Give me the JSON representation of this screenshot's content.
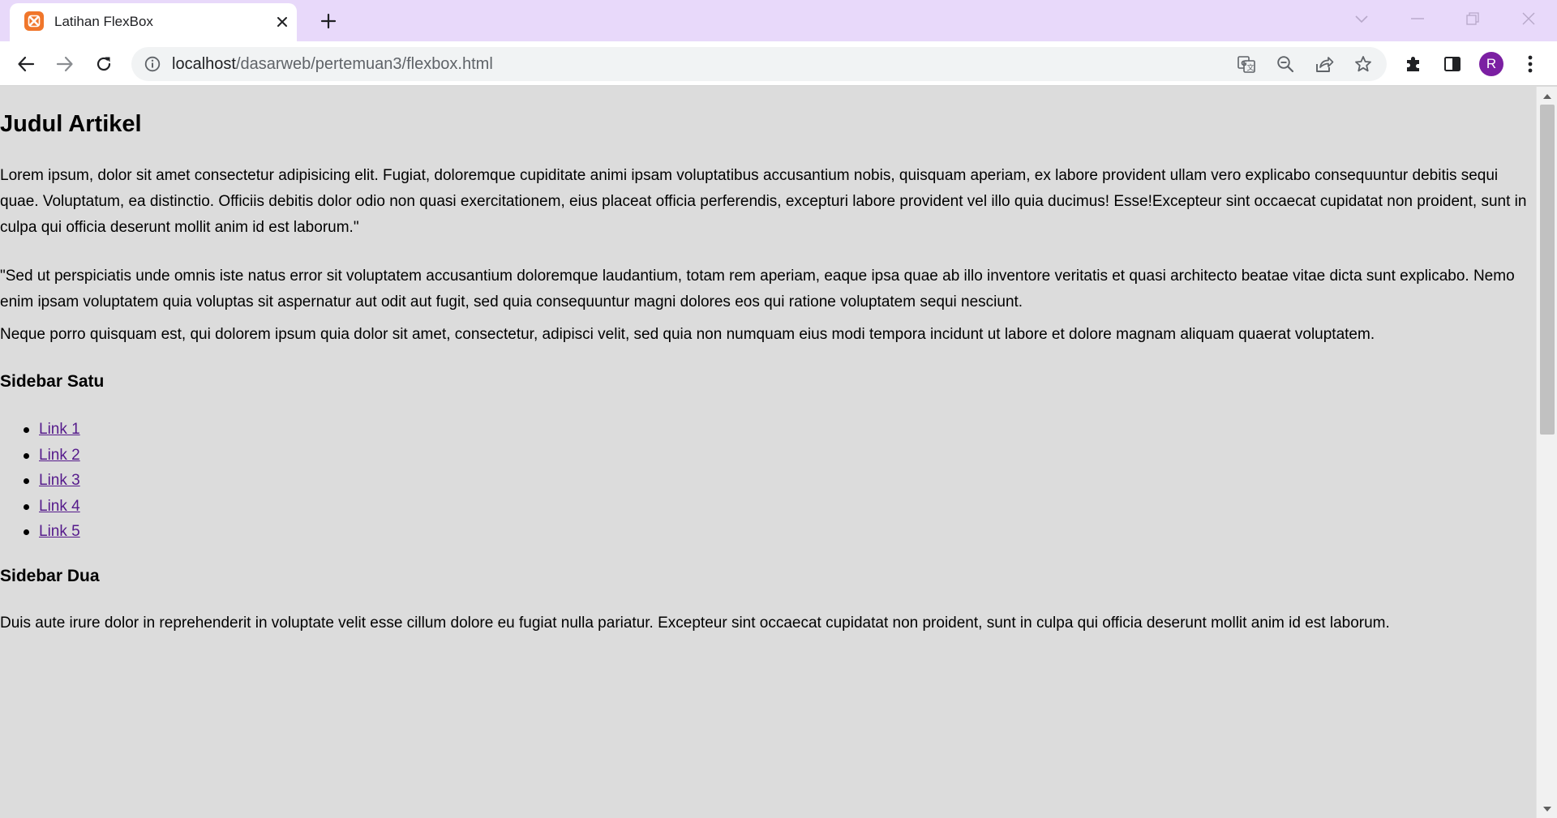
{
  "browser": {
    "tab_title": "Latihan FlexBox",
    "url_host": "localhost",
    "url_path": "/dasarweb/pertemuan3/flexbox.html",
    "profile_initial": "R",
    "accent_color": "#e8d9fa",
    "profile_color": "#7b1fa2"
  },
  "icons": {
    "favicon": "xampp-icon",
    "close": "close-icon",
    "new_tab": "plus-icon",
    "back": "arrow-left-icon",
    "forward": "arrow-right-icon",
    "reload": "reload-icon",
    "info": "info-icon",
    "translate": "translate-icon",
    "zoom": "zoom-out-icon",
    "share": "share-icon",
    "bookmark": "star-icon",
    "extensions": "puzzle-icon",
    "side_panel": "side-panel-icon",
    "menu": "kebab-menu-icon"
  },
  "page": {
    "title": "Judul Artikel",
    "paragraphs": [
      "Lorem ipsum, dolor sit amet consectetur adipisicing elit. Fugiat, doloremque cupiditate animi ipsam voluptatibus accusantium nobis, quisquam aperiam, ex labore provident ullam vero explicabo consequuntur debitis sequi quae. Voluptatum, ea distinctio. Officiis debitis dolor odio non quasi exercitationem, eius placeat officia perferendis, excepturi labore provident vel illo quia ducimus! Esse!Excepteur sint occaecat cupidatat non proident, sunt in culpa qui officia deserunt mollit anim id est laborum.\"",
      "\"Sed ut perspiciatis unde omnis iste natus error sit voluptatem accusantium doloremque laudantium, totam rem aperiam, eaque ipsa quae ab illo inventore veritatis et quasi architecto beatae vitae dicta sunt explicabo. Nemo enim ipsam voluptatem quia voluptas sit aspernatur aut odit aut fugit, sed quia consequuntur magni dolores eos qui ratione voluptatem sequi nesciunt.",
      "Neque porro quisquam est, qui dolorem ipsum quia dolor sit amet, consectetur, adipisci velit, sed quia non numquam eius modi tempora incidunt ut labore et dolore magnam aliquam quaerat voluptatem."
    ],
    "sidebar_one": {
      "title": "Sidebar Satu",
      "links": [
        "Link 1",
        "Link 2",
        "Link 3",
        "Link 4",
        "Link 5"
      ]
    },
    "sidebar_two": {
      "title": "Sidebar Dua",
      "text": "Duis aute irure dolor in reprehenderit in voluptate velit esse cillum dolore eu fugiat nulla pariatur. Excepteur sint occaecat cupidatat non proident, sunt in culpa qui officia deserunt mollit anim id est laborum."
    }
  }
}
